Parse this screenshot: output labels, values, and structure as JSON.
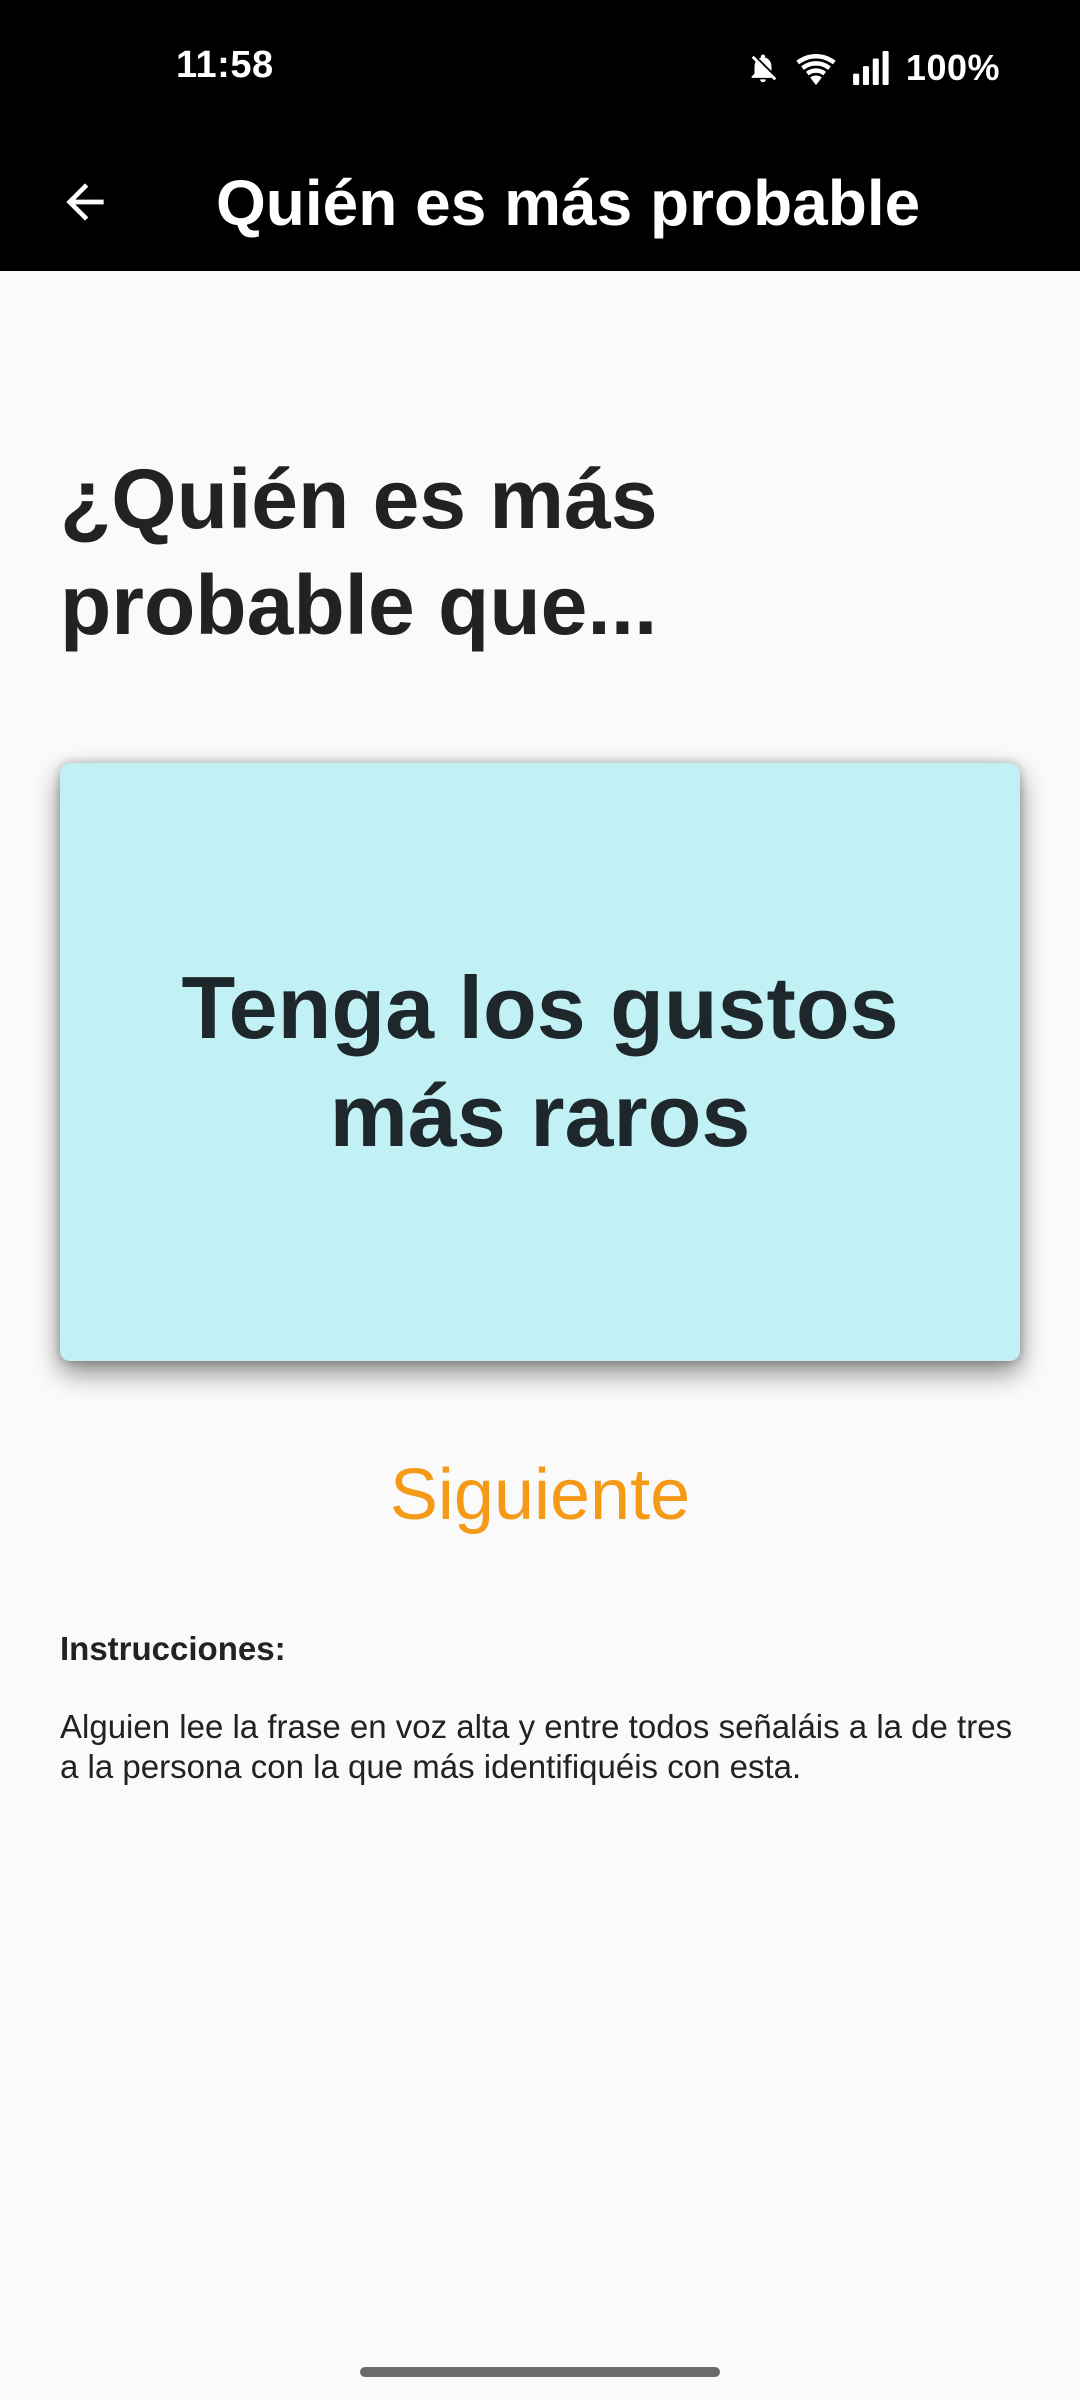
{
  "status_bar": {
    "time": "11:58",
    "battery": "100%",
    "icons": [
      "bell-off-icon",
      "wifi-icon",
      "signal-icon"
    ]
  },
  "app_bar": {
    "title": "Quién es más probable",
    "back_icon": "arrow-left-icon"
  },
  "main": {
    "heading": "¿Quién es más probable que...",
    "card_text": "Tenga los gustos más raros",
    "card_color": "#c2f1f5",
    "next_label": "Siguiente",
    "accent_color": "#f59a16",
    "instructions_title": "Instrucciones:",
    "instructions_text": "Alguien lee la frase en voz alta y entre todos señaláis a la de tres a la persona con la que más identifiquéis con esta."
  }
}
